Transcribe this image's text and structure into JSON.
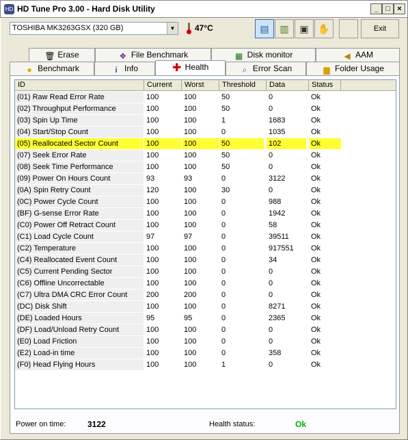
{
  "window": {
    "title": "HD Tune Pro 3.00 - Hard Disk Utility",
    "controls": {
      "minimize": "_",
      "maximize": "□",
      "close": "×"
    }
  },
  "toolbar": {
    "drive": "TOSHIBA MK3263GSX (320 GB)",
    "temperature": "47°C",
    "exit_label": "Exit"
  },
  "tabs_top": [
    {
      "label": "Erase",
      "icon": "trash-icon"
    },
    {
      "label": "File Benchmark",
      "icon": "file-benchmark-icon"
    },
    {
      "label": "Disk monitor",
      "icon": "disk-monitor-icon"
    },
    {
      "label": "AAM",
      "icon": "speaker-icon"
    }
  ],
  "tabs_bottom": [
    {
      "label": "Benchmark",
      "icon": "lightbulb-icon"
    },
    {
      "label": "Info",
      "icon": "info-icon"
    },
    {
      "label": "Health",
      "icon": "health-cross-icon",
      "selected": true
    },
    {
      "label": "Error Scan",
      "icon": "magnifier-icon"
    },
    {
      "label": "Folder Usage",
      "icon": "folder-icon"
    }
  ],
  "health": {
    "columns": [
      "ID",
      "Current",
      "Worst",
      "Threshold",
      "Data",
      "Status"
    ],
    "rows": [
      [
        "(01) Raw Read Error Rate",
        "100",
        "100",
        "50",
        "0",
        "Ok"
      ],
      [
        "(02) Throughput Performance",
        "100",
        "100",
        "50",
        "0",
        "Ok"
      ],
      [
        "(03) Spin Up Time",
        "100",
        "100",
        "1",
        "1683",
        "Ok"
      ],
      [
        "(04) Start/Stop Count",
        "100",
        "100",
        "0",
        "1035",
        "Ok"
      ],
      [
        "(05) Reallocated Sector Count",
        "100",
        "100",
        "50",
        "102",
        "Ok"
      ],
      [
        "(07) Seek Error Rate",
        "100",
        "100",
        "50",
        "0",
        "Ok"
      ],
      [
        "(08) Seek Time Performance",
        "100",
        "100",
        "50",
        "0",
        "Ok"
      ],
      [
        "(09) Power On Hours Count",
        "93",
        "93",
        "0",
        "3122",
        "Ok"
      ],
      [
        "(0A) Spin Retry Count",
        "120",
        "100",
        "30",
        "0",
        "Ok"
      ],
      [
        "(0C) Power Cycle Count",
        "100",
        "100",
        "0",
        "988",
        "Ok"
      ],
      [
        "(BF) G-sense Error Rate",
        "100",
        "100",
        "0",
        "1942",
        "Ok"
      ],
      [
        "(C0) Power Off Retract Count",
        "100",
        "100",
        "0",
        "58",
        "Ok"
      ],
      [
        "(C1) Load Cycle Count",
        "97",
        "97",
        "0",
        "39511",
        "Ok"
      ],
      [
        "(C2) Temperature",
        "100",
        "100",
        "0",
        "917551",
        "Ok"
      ],
      [
        "(C4) Reallocated Event Count",
        "100",
        "100",
        "0",
        "34",
        "Ok"
      ],
      [
        "(C5) Current Pending Sector",
        "100",
        "100",
        "0",
        "0",
        "Ok"
      ],
      [
        "(C6) Offline Uncorrectable",
        "100",
        "100",
        "0",
        "0",
        "Ok"
      ],
      [
        "(C7) Ultra DMA CRC Error Count",
        "200",
        "200",
        "0",
        "0",
        "Ok"
      ],
      [
        "(DC) Disk Shift",
        "100",
        "100",
        "0",
        "8271",
        "Ok"
      ],
      [
        "(DE) Loaded Hours",
        "95",
        "95",
        "0",
        "2365",
        "Ok"
      ],
      [
        "(DF) Load/Unload Retry Count",
        "100",
        "100",
        "0",
        "0",
        "Ok"
      ],
      [
        "(E0) Load Friction",
        "100",
        "100",
        "0",
        "0",
        "Ok"
      ],
      [
        "(E2) Load-in time",
        "100",
        "100",
        "0",
        "358",
        "Ok"
      ],
      [
        "(F0) Head Flying Hours",
        "100",
        "100",
        "1",
        "0",
        "Ok"
      ]
    ],
    "highlight_color": "#ffff33"
  },
  "footer": {
    "power_on_label": "Power on time:",
    "power_on_value": "3122",
    "health_label": "Health status:",
    "health_value": "Ok",
    "health_color": "#00b000"
  }
}
